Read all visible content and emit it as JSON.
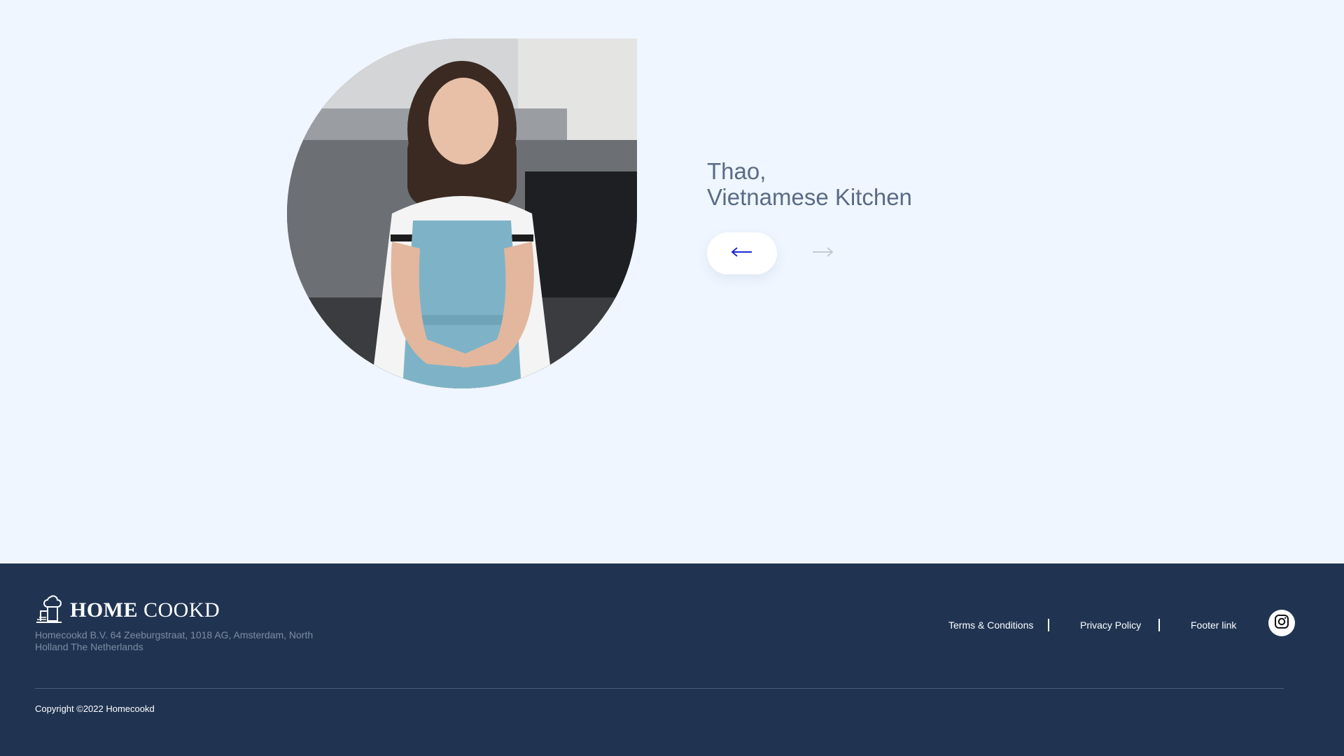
{
  "chef": {
    "name": "Thao,",
    "kitchen": "Vietnamese Kitchen",
    "photo_icon": "chef-portrait-image"
  },
  "carousel": {
    "prev_icon": "arrow-left-icon",
    "next_icon": "arrow-right-icon",
    "prev_color": "#1f2bd0",
    "next_color": "#c5c9d6"
  },
  "footer": {
    "logo_icon": "chef-hat-house-icon",
    "logo_bold": "HOME",
    "logo_light": "COOKD",
    "address": "Homecookd B.V. 64 Zeeburgstraat, 1018 AG, Amsterdam, North Holland The Netherlands",
    "links": [
      {
        "label": "Terms & Conditions"
      },
      {
        "label": "Privacy Policy"
      },
      {
        "label": "Footer link"
      }
    ],
    "social_icon": "instagram-icon",
    "copyright": "Copyright ©2022 Homecookd"
  },
  "colors": {
    "background": "#eff6ff",
    "footer_bg": "#203452",
    "text_muted": "#5a6b85"
  }
}
